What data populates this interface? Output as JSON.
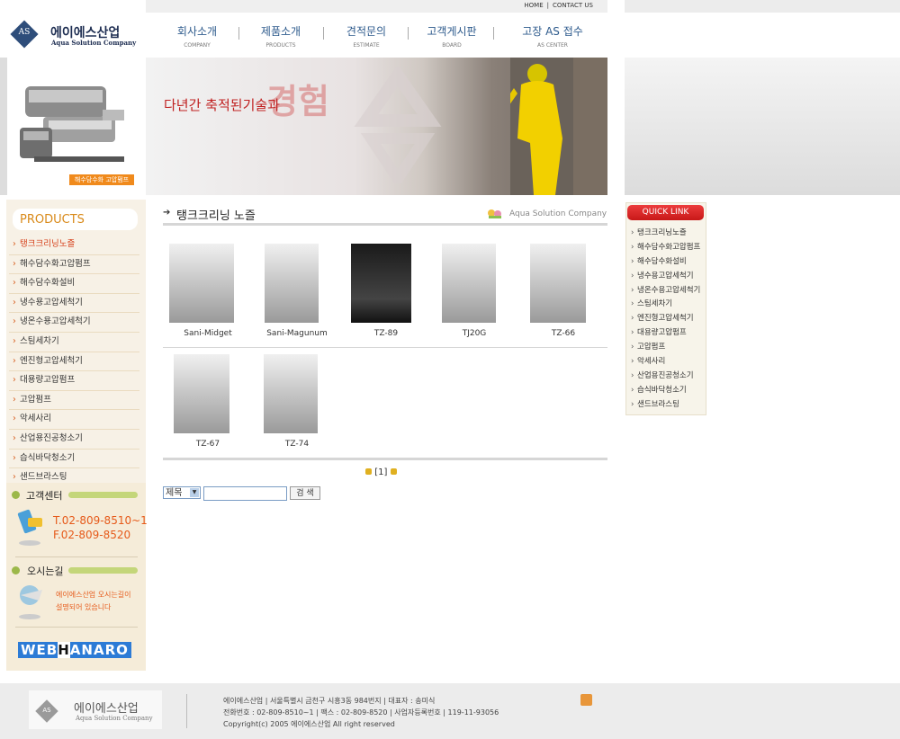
{
  "top_links": [
    "HOME",
    "CONTACT US"
  ],
  "logo": {
    "name": "에이에스산업",
    "sub": "Aqua Solution Company",
    "mark": "AS"
  },
  "nav": [
    {
      "ko": "회사소개",
      "en": "COMPANY"
    },
    {
      "ko": "제품소개",
      "en": "PRODUCTS"
    },
    {
      "ko": "견적문의",
      "en": "ESTIMATE"
    },
    {
      "ko": "고객게시판",
      "en": "BOARD"
    },
    {
      "ko": "고장 AS 접수",
      "en": "AS CENTER"
    }
  ],
  "banner": {
    "tagline": "다년간 축적된기술과",
    "big": "경험",
    "pump_tag": "해수담수화 고압펌프"
  },
  "sidebar": {
    "title": "PRODUCTS",
    "items": [
      "탱크크리닝노즐",
      "해수담수화고압펌프",
      "해수담수화설비",
      "냉수용고압세척기",
      "냉온수용고압세척기",
      "스팀세차기",
      "엔진형고압세척기",
      "대용량고압펌프",
      "고압펌프",
      "악세사리",
      "산업용진공청소기",
      "습식바닥청소기",
      "샌드브라스팅"
    ],
    "active_index": 0,
    "cs_title": "고객센터",
    "tel": "T.02-809-8510~1",
    "fax": "F.02-809-8520",
    "map_title": "오시는길",
    "map_text_1": "에이에스산업 오시는길이",
    "map_text_2": "설명되어 있습니다",
    "banner_a": "WEB",
    "banner_b": "H",
    "banner_c": "ANARO"
  },
  "main": {
    "title": "탱크크리닝 노즐",
    "brand": "Aqua Solution Company",
    "products": [
      "Sani-Midget",
      "Sani-Magunum",
      "TZ-89",
      "TJ20G",
      "TZ-66",
      "TZ-67",
      "TZ-74"
    ],
    "pager": "[1]",
    "search_select": "제목",
    "search_button": "검 색"
  },
  "quick_link": {
    "title": "QUICK LINK",
    "items": [
      "탱크크리닝노즐",
      "해수담수화고압펌프",
      "해수담수화설비",
      "냉수용고압세척기",
      "냉온수용고압세척기",
      "스팀세차기",
      "엔진형고압세척기",
      "대용량고압펌프",
      "고압펌프",
      "악세사리",
      "산업용진공청소기",
      "습식바닥청소기",
      "샌드브라스팅"
    ]
  },
  "footer": {
    "logo_name": "에이에스산업",
    "logo_sub": "Aqua Solution Company",
    "line1": "에이에스산업 | 서울특별시 금천구 시흥3동 984번지 | 대표자 : 송미식",
    "line2": "전화번호 : 02-809-8510~1 | 팩스 : 02-809-8520 | 사업자등록번호 | 119-11-93056",
    "line3": "Copyright(c) 2005 에이에스산업 All right reserved"
  }
}
